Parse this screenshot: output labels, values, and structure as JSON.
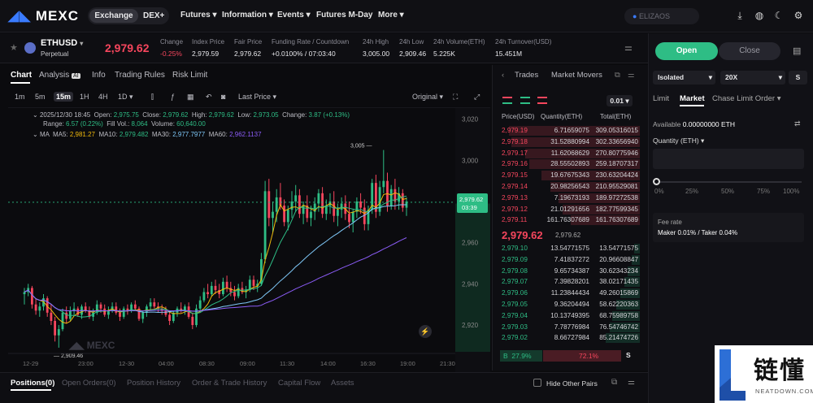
{
  "nav": {
    "brand": "MEXC",
    "segment": {
      "active": "Exchange",
      "other": "DEX+"
    },
    "items": [
      "Futures",
      "Information",
      "Events",
      "Futures M-Day",
      "More"
    ],
    "search_placeholder": "ELIZAOS"
  },
  "ticker": {
    "symbol": "ETHUSD",
    "sub": "Perpetual",
    "last_price": "2,979.62",
    "stats": [
      {
        "label": "Change",
        "value": "-0.25%"
      },
      {
        "label": "Index Price",
        "value": "2,979.59"
      },
      {
        "label": "Fair Price",
        "value": "2,979.62"
      },
      {
        "label": "Funding Rate / Countdown",
        "value": "+0.0100% / 07:03:40"
      },
      {
        "label": "24h High",
        "value": "3,005.00"
      },
      {
        "label": "24h Low",
        "value": "2,909.46"
      },
      {
        "label": "24h Volume(ETH)",
        "value": "5.225K"
      },
      {
        "label": "24h Turnover(USD)",
        "value": "15.451M"
      }
    ]
  },
  "chart_tabs": {
    "items": [
      "Chart",
      "Analysis",
      "Info",
      "Trading Rules",
      "Risk Limit"
    ],
    "analysis_badge": "AI",
    "active": "Chart"
  },
  "timeframes": {
    "items": [
      "1m",
      "5m",
      "15m",
      "1H",
      "4H",
      "1D"
    ],
    "active": "15m",
    "last_price_label": "Last Price",
    "original_label": "Original"
  },
  "legend": {
    "date": "2025/12/30 18:45",
    "open_label": "Open:",
    "open": "2,975.75",
    "close_label": "Close:",
    "close": "2,979.62",
    "high_label": "High:",
    "high": "2,979.62",
    "low_label": "Low:",
    "low": "2,973.05",
    "change_label": "Change:",
    "change": "3.87 (+0.13%)",
    "range_label": "Range:",
    "range": "6.57 (0.22%)",
    "fillvol_label": "Fill Vol.:",
    "fillvol": "8,064",
    "volume_label": "Volume:",
    "volume": "60,640.00",
    "ma_label": "MA",
    "ma5_label": "MA5:",
    "ma5": "2,981.27",
    "ma10_label": "MA10:",
    "ma10": "2,979.482",
    "ma30_label": "MA30:",
    "ma30": "2,977.7977",
    "ma60_label": "MA60:",
    "ma60": "2,962.1137"
  },
  "chart_data": {
    "type": "candlestick",
    "x_ticks": [
      "12-29",
      "23:00",
      "12-30",
      "04:00",
      "08:30",
      "09:00",
      "11:30",
      "14:00",
      "16:30",
      "19:00",
      "21:30"
    ],
    "y_ticks": [
      3020,
      3000,
      2980,
      2960,
      2940,
      2920
    ],
    "ylim": [
      2907,
      3023
    ],
    "price_tag": "2,979.62",
    "countdown_tag": "03:39",
    "high_marker": "3,005",
    "low_marker": "2,909.46",
    "watermark": "MEXC",
    "candles": [
      [
        2935,
        2938,
        2930,
        2936
      ],
      [
        2936,
        2940,
        2934,
        2938
      ],
      [
        2938,
        2939,
        2928,
        2930
      ],
      [
        2930,
        2933,
        2925,
        2927
      ],
      [
        2927,
        2931,
        2924,
        2929
      ],
      [
        2929,
        2935,
        2927,
        2933
      ],
      [
        2933,
        2934,
        2924,
        2926
      ],
      [
        2926,
        2930,
        2920,
        2922
      ],
      [
        2922,
        2924,
        2912,
        2915
      ],
      [
        2915,
        2920,
        2909,
        2918
      ],
      [
        2918,
        2928,
        2917,
        2926
      ],
      [
        2926,
        2929,
        2921,
        2923
      ],
      [
        2923,
        2929,
        2922,
        2927
      ],
      [
        2927,
        2931,
        2925,
        2928
      ],
      [
        2928,
        2929,
        2924,
        2925
      ],
      [
        2925,
        2930,
        2923,
        2929
      ],
      [
        2929,
        2931,
        2926,
        2927
      ],
      [
        2927,
        2929,
        2923,
        2924
      ],
      [
        2924,
        2928,
        2922,
        2926
      ],
      [
        2926,
        2932,
        2925,
        2930
      ],
      [
        2930,
        2931,
        2926,
        2928
      ],
      [
        2928,
        2930,
        2924,
        2925
      ],
      [
        2925,
        2929,
        2923,
        2927
      ],
      [
        2927,
        2931,
        2926,
        2929
      ],
      [
        2929,
        2931,
        2925,
        2926
      ],
      [
        2926,
        2928,
        2922,
        2924
      ],
      [
        2924,
        2929,
        2923,
        2928
      ],
      [
        2928,
        2930,
        2925,
        2927
      ],
      [
        2927,
        2931,
        2926,
        2930
      ],
      [
        2930,
        2932,
        2927,
        2928
      ],
      [
        2928,
        2929,
        2922,
        2923
      ],
      [
        2923,
        2927,
        2921,
        2926
      ],
      [
        2926,
        2930,
        2924,
        2929
      ],
      [
        2929,
        2933,
        2927,
        2931
      ],
      [
        2931,
        2933,
        2928,
        2929
      ],
      [
        2929,
        2931,
        2926,
        2928
      ],
      [
        2928,
        2930,
        2925,
        2927
      ],
      [
        2927,
        2929,
        2924,
        2925
      ],
      [
        2925,
        2927,
        2920,
        2922
      ],
      [
        2922,
        2927,
        2921,
        2926
      ],
      [
        2926,
        2929,
        2924,
        2928
      ],
      [
        2928,
        2931,
        2926,
        2927
      ],
      [
        2927,
        2930,
        2925,
        2929
      ],
      [
        2929,
        2931,
        2923,
        2924
      ],
      [
        2924,
        2926,
        2918,
        2920
      ],
      [
        2920,
        2930,
        2919,
        2928
      ],
      [
        2928,
        2934,
        2927,
        2932
      ],
      [
        2932,
        2938,
        2931,
        2936
      ],
      [
        2936,
        2940,
        2933,
        2935
      ],
      [
        2935,
        2941,
        2934,
        2939
      ],
      [
        2939,
        2942,
        2935,
        2937
      ],
      [
        2937,
        2940,
        2933,
        2935
      ],
      [
        2935,
        2943,
        2934,
        2941
      ],
      [
        2941,
        2944,
        2936,
        2938
      ],
      [
        2938,
        2941,
        2934,
        2936
      ],
      [
        2936,
        2939,
        2932,
        2934
      ],
      [
        2934,
        2940,
        2933,
        2938
      ],
      [
        2938,
        2941,
        2935,
        2936
      ],
      [
        2936,
        2939,
        2933,
        2937
      ],
      [
        2937,
        2944,
        2936,
        2942
      ],
      [
        2942,
        2944,
        2937,
        2939
      ],
      [
        2939,
        2942,
        2936,
        2940
      ],
      [
        2940,
        2955,
        2939,
        2952
      ],
      [
        2952,
        2990,
        2950,
        2985
      ],
      [
        2985,
        2991,
        2968,
        2972
      ],
      [
        2972,
        2980,
        2965,
        2975
      ],
      [
        2975,
        2986,
        2970,
        2982
      ],
      [
        2982,
        2989,
        2976,
        2978
      ],
      [
        2978,
        2981,
        2968,
        2970
      ],
      [
        2970,
        2978,
        2966,
        2976
      ],
      [
        2976,
        2985,
        2972,
        2980
      ],
      [
        2980,
        2988,
        2975,
        2983
      ],
      [
        2983,
        2986,
        2972,
        2974
      ],
      [
        2974,
        2980,
        2969,
        2978
      ],
      [
        2978,
        2983,
        2970,
        2972
      ],
      [
        2972,
        2978,
        2968,
        2975
      ],
      [
        2975,
        2982,
        2971,
        2979
      ],
      [
        2979,
        2986,
        2975,
        2984
      ],
      [
        2984,
        2987,
        2972,
        2974
      ],
      [
        2974,
        2981,
        2971,
        2978
      ],
      [
        2978,
        2984,
        2974,
        2980
      ],
      [
        2980,
        2985,
        2970,
        2973
      ],
      [
        2973,
        2979,
        2968,
        2976
      ],
      [
        2976,
        2982,
        2972,
        2979
      ],
      [
        2979,
        2983,
        2971,
        2974
      ],
      [
        2974,
        2980,
        2967,
        2970
      ],
      [
        2970,
        2976,
        2965,
        2975
      ],
      [
        2975,
        2982,
        2972,
        2980
      ],
      [
        2980,
        2984,
        2974,
        2977
      ],
      [
        2977,
        2981,
        2966,
        2969
      ],
      [
        2969,
        2978,
        2966,
        2976
      ],
      [
        2976,
        2991,
        2974,
        2989
      ],
      [
        2989,
        2993,
        2972,
        2975
      ],
      [
        2975,
        2990,
        2973,
        2987
      ],
      [
        2987,
        3005,
        2984,
        2990
      ],
      [
        2990,
        2994,
        2975,
        2978
      ],
      [
        2978,
        2988,
        2976,
        2986
      ],
      [
        2986,
        2991,
        2976,
        2980
      ],
      [
        2980,
        2987,
        2976,
        2984
      ],
      [
        2984,
        2986,
        2975,
        2977
      ],
      [
        2977,
        2982,
        2973,
        2980
      ]
    ],
    "ma_colors": {
      "ma5": "#f0b90b",
      "ma10": "#2ebd85",
      "ma30": "#7fc8f8",
      "ma60": "#8b5cf6"
    }
  },
  "orderbook": {
    "tabs": [
      "Trades",
      "Market Movers"
    ],
    "precision": "0.01",
    "headers": [
      "Price(USD)",
      "Quantity(ETH)",
      "Total(ETH)"
    ],
    "asks": [
      [
        "2,979.19",
        "6.71659075",
        "309.05316015",
        0.95
      ],
      [
        "2,979.18",
        "31.52880994",
        "302.33656940",
        0.93
      ],
      [
        "2,979.17",
        "11.62068629",
        "270.80775946",
        0.83
      ],
      [
        "2,979.16",
        "28.55502893",
        "259.18707317",
        0.8
      ],
      [
        "2,979.15",
        "19.67675343",
        "230.63204424",
        0.71
      ],
      [
        "2,979.14",
        "20.98256543",
        "210.95529081",
        0.65
      ],
      [
        "2,979.13",
        "7.19673193",
        "189.97272538",
        0.59
      ],
      [
        "2,979.12",
        "21.01291656",
        "182.77599345",
        0.56
      ],
      [
        "2,979.11",
        "161.76307689",
        "161.76307689",
        0.5
      ]
    ],
    "mid_price": "2,979.62",
    "mid_sub": "2,979.62",
    "bids": [
      [
        "2,979.10",
        "13.54771575",
        "13.54771575",
        0.04
      ],
      [
        "2,979.09",
        "7.41837272",
        "20.96608847",
        0.06
      ],
      [
        "2,979.08",
        "9.65734387",
        "30.62343234",
        0.09
      ],
      [
        "2,979.07",
        "7.39828201",
        "38.02171435",
        0.11
      ],
      [
        "2,979.06",
        "11.23844434",
        "49.26015869",
        0.14
      ],
      [
        "2,979.05",
        "9.36204494",
        "58.62220363",
        0.17
      ],
      [
        "2,979.04",
        "10.13749395",
        "68.75989758",
        0.2
      ],
      [
        "2,979.03",
        "7.78776984",
        "76.54746742",
        0.22
      ],
      [
        "2,979.02",
        "8.66727984",
        "85.21474726",
        0.25
      ]
    ],
    "buy_label": "B",
    "buy_pct": "27.9%",
    "sell_pct": "72.1%",
    "sell_label": "S"
  },
  "trade": {
    "open": "Open",
    "close": "Close",
    "margin_mode": "Isolated",
    "leverage": "20X",
    "mode_badge": "S",
    "order_tabs": [
      "Limit",
      "Market",
      "Chase Limit Order"
    ],
    "order_active": "Market",
    "available_label": "Available",
    "available": "0.00000000 ETH",
    "quantity_label": "Quantity (ETH)",
    "slider_ticks": [
      "0%",
      "25%",
      "50%",
      "75%",
      "100%"
    ],
    "fee_label": "Fee rate",
    "fee_value": "Maker 0.01% / Taker 0.04%"
  },
  "bottom": {
    "tabs": [
      "Positions(0)",
      "Open Orders(0)",
      "Position History",
      "Order & Trade History",
      "Capital Flow",
      "Assets"
    ],
    "hide_pairs": "Hide Other Pairs"
  },
  "watermark": {
    "cn": "链懂",
    "url": "NEATDOWN.COM"
  },
  "colors": {
    "up": "#2ebd85",
    "down": "#f6465d",
    "accent": "#3a7bff"
  }
}
